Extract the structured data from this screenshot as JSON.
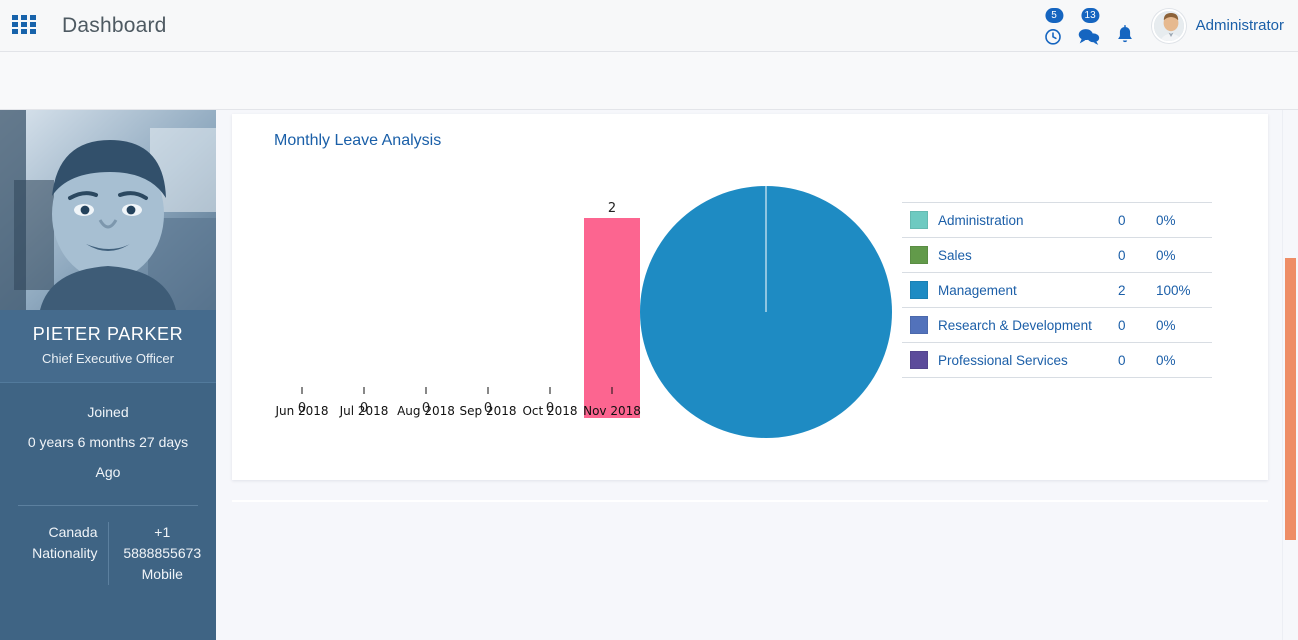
{
  "header": {
    "apps_icon": "apps-grid-icon",
    "title": "Dashboard",
    "clock_icon": "clock-icon",
    "clock_badge": "5",
    "chat_icon": "chat-bubbles-icon",
    "chat_badge": "13",
    "bell_icon": "bell-icon",
    "avatar_icon": "user-avatar",
    "admin_label": "Administrator"
  },
  "sidebar": {
    "photo_alt": "employee-photo",
    "employee_name": "PIETER PARKER",
    "employee_role": "Chief Executive Officer",
    "joined_label": "Joined",
    "joined_duration": "0 years 6 months 27 days",
    "joined_ago": "Ago",
    "nationality_value": "Canada",
    "nationality_label": "Nationality",
    "mobile_value": "+1 5888855673",
    "mobile_label": "Mobile"
  },
  "card": {
    "title": "Monthly Leave Analysis"
  },
  "legend": {
    "rows": [
      {
        "label": "Administration",
        "count": "0",
        "pct": "0%",
        "color": "#6ecac1"
      },
      {
        "label": "Sales",
        "count": "0",
        "pct": "0%",
        "color": "#629a4a"
      },
      {
        "label": "Management",
        "count": "2",
        "pct": "100%",
        "color": "#1e8bc3"
      },
      {
        "label": "Research & Development",
        "count": "0",
        "pct": "0%",
        "color": "#5272bb"
      },
      {
        "label": "Professional Services",
        "count": "0",
        "pct": "0%",
        "color": "#5c4b9b"
      }
    ]
  },
  "scrollbar": {
    "thumb_color": "#ee8d66"
  },
  "chart_data": [
    {
      "type": "bar",
      "title": "Monthly Leave Analysis",
      "categories": [
        "Jun 2018",
        "Jul 2018",
        "Aug 2018",
        "Sep 2018",
        "Oct 2018",
        "Nov 2018"
      ],
      "values": [
        0,
        0,
        0,
        0,
        0,
        2
      ],
      "data_labels": [
        "0",
        "0",
        "0",
        "0",
        "0",
        "2"
      ],
      "bar_color": "#fc6590",
      "xlabel": "",
      "ylabel": "",
      "ylim": [
        0,
        2
      ],
      "grid": false,
      "legend": "none"
    },
    {
      "type": "pie",
      "title": "",
      "labels": [
        "Administration",
        "Sales",
        "Management",
        "Research & Development",
        "Professional Services"
      ],
      "values": [
        0,
        0,
        2,
        0,
        0
      ],
      "percentages": [
        "0%",
        "0%",
        "100%",
        "0%",
        "0%"
      ],
      "colors": [
        "#6ecac1",
        "#629a4a",
        "#1e8bc3",
        "#5272bb",
        "#5c4b9b"
      ],
      "legend": "right-table",
      "start_angle": 90
    }
  ]
}
